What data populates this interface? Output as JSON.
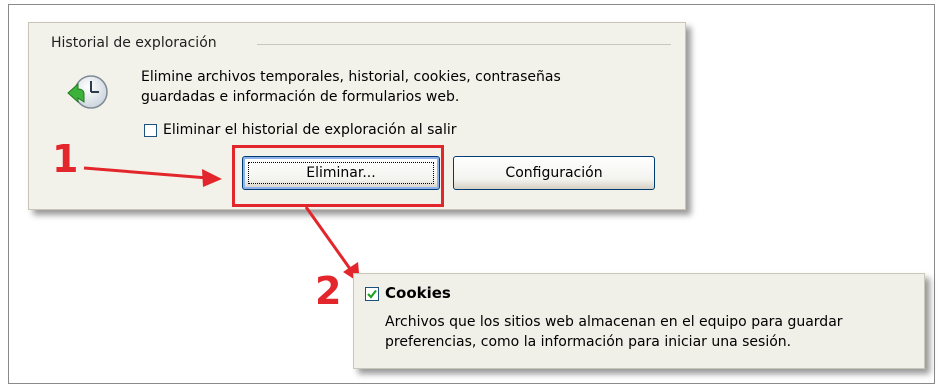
{
  "history_panel": {
    "group_title": "Historial de exploración",
    "description_line1": "Elimine archivos temporales, historial, cookies, contraseñas",
    "description_line2": "guardadas e información de formularios web.",
    "checkbox_label": "Eliminar el historial de exploración al salir",
    "checkbox_checked": false,
    "delete_button_label": "Eliminar...",
    "settings_button_label": "Configuración"
  },
  "cookies_panel": {
    "checkbox_label": "Cookies",
    "checkbox_checked": true,
    "description_line1": "Archivos que los sitios web almacenan en el equipo para guardar",
    "description_line2": "preferencias, como la información para iniciar una sesión."
  },
  "annotations": {
    "step1": "1",
    "step2": "2"
  },
  "icons": {
    "history": "history-clock-icon",
    "check": "checkmark-icon"
  },
  "colors": {
    "annotation_red": "#e3262b",
    "panel_bg": "#f3f2ea",
    "button_border": "#003c74"
  }
}
